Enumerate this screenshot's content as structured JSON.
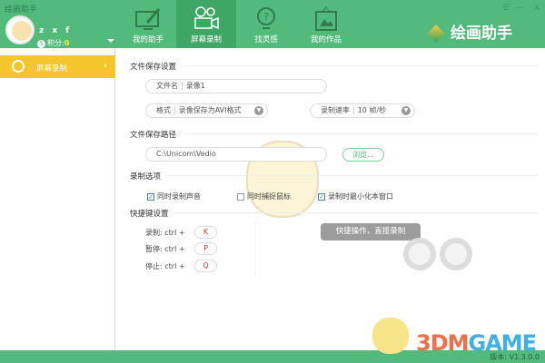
{
  "app_title": "绘画助手",
  "user": {
    "name": "z x f",
    "score_label": "积分:",
    "score": "0",
    "badge": "S"
  },
  "tabs": [
    {
      "label": "我的助手",
      "icon": "monitor-pen-icon"
    },
    {
      "label": "屏幕录制",
      "icon": "camera-icon",
      "active": true
    },
    {
      "label": "找灵感",
      "icon": "lightbulb-question-icon"
    },
    {
      "label": "我的作品",
      "icon": "picture-frame-icon"
    }
  ],
  "window_controls": {
    "menu": "☰",
    "minimize": "—",
    "close": "X"
  },
  "logo_text": "绘画助手",
  "sidebar": {
    "items": [
      {
        "label": "屏幕录制",
        "chevron": "›"
      }
    ]
  },
  "file_settings": {
    "title": "文件保存设置",
    "filename_label": "文件名",
    "filename_value": "录像1",
    "format_label": "格式",
    "format_value": "录像保存为AVI格式",
    "rate_label": "录制速率",
    "rate_value": "10 帧/秒"
  },
  "path": {
    "title": "文件保存路径",
    "value": "C:\\Unicom\\Vedio",
    "browse": "浏览..."
  },
  "options": {
    "title": "录制选项",
    "items": [
      {
        "label": "同时录制声音",
        "checked": true
      },
      {
        "label": "同时捕捉鼠标",
        "checked": false
      },
      {
        "label": "录制时最小化本窗口",
        "checked": true
      }
    ]
  },
  "hotkeys": {
    "title": "快捷键设置",
    "items": [
      {
        "label": "录制:",
        "mod": "ctrl +",
        "key": "K"
      },
      {
        "label": "暂停:",
        "mod": "ctrl +",
        "key": "P"
      },
      {
        "label": "停止:",
        "mod": "ctrl +",
        "key": "Q"
      }
    ],
    "tip": "快捷操作，直接录制"
  },
  "version": "版本: V1.3.0.0",
  "watermark": {
    "a": "3DM",
    "b": "GAME"
  },
  "colors": {
    "primary": "#52bb7c",
    "active_tab": "#3fa765",
    "sidebar_active": "#f5c52d"
  }
}
